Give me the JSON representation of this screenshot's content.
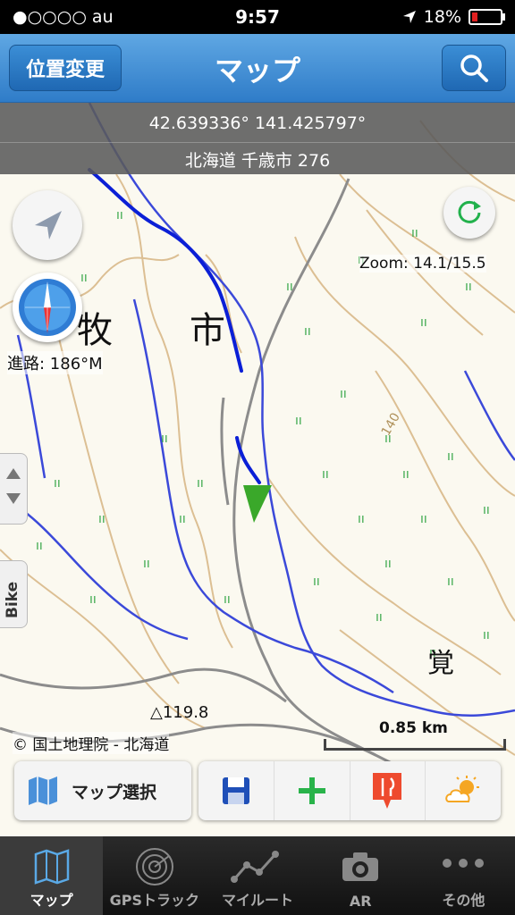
{
  "status_bar": {
    "carrier": "●○○○○ au",
    "time": "9:57",
    "battery": "18%",
    "battery_level": 0.18
  },
  "navbar": {
    "left_button": "位置変更",
    "title": "マップ"
  },
  "coords": {
    "latlon": "42.639336° 141.425797°",
    "address": "北海道 千歳市 276"
  },
  "map": {
    "zoom": "Zoom: 14.1/15.5",
    "heading": "進路: 186°M",
    "side_tab": "Bike",
    "copyright": "© 国土地理院 - 北海道",
    "scale": "0.85 km",
    "kanji_labels": [
      "牧",
      "市",
      "覚"
    ],
    "contour_label": "140",
    "summit_label": "△119.8",
    "colors": {
      "track": "#0b1fd6",
      "river": "#3b49d9",
      "arrow": "#3aa82a"
    }
  },
  "toolbar": {
    "map_select": "マップ選択",
    "icons": [
      "map-icon",
      "save-icon",
      "add-icon",
      "restaurant-icon",
      "weather-icon"
    ]
  },
  "tabbar": {
    "tabs": [
      {
        "label": "マップ",
        "icon": "map-icon",
        "active": true
      },
      {
        "label": "GPSトラック",
        "icon": "radar-icon",
        "active": false
      },
      {
        "label": "マイルート",
        "icon": "route-icon",
        "active": false
      },
      {
        "label": "AR",
        "icon": "camera-icon",
        "active": false
      },
      {
        "label": "その他",
        "icon": "more-icon",
        "active": false
      }
    ]
  }
}
